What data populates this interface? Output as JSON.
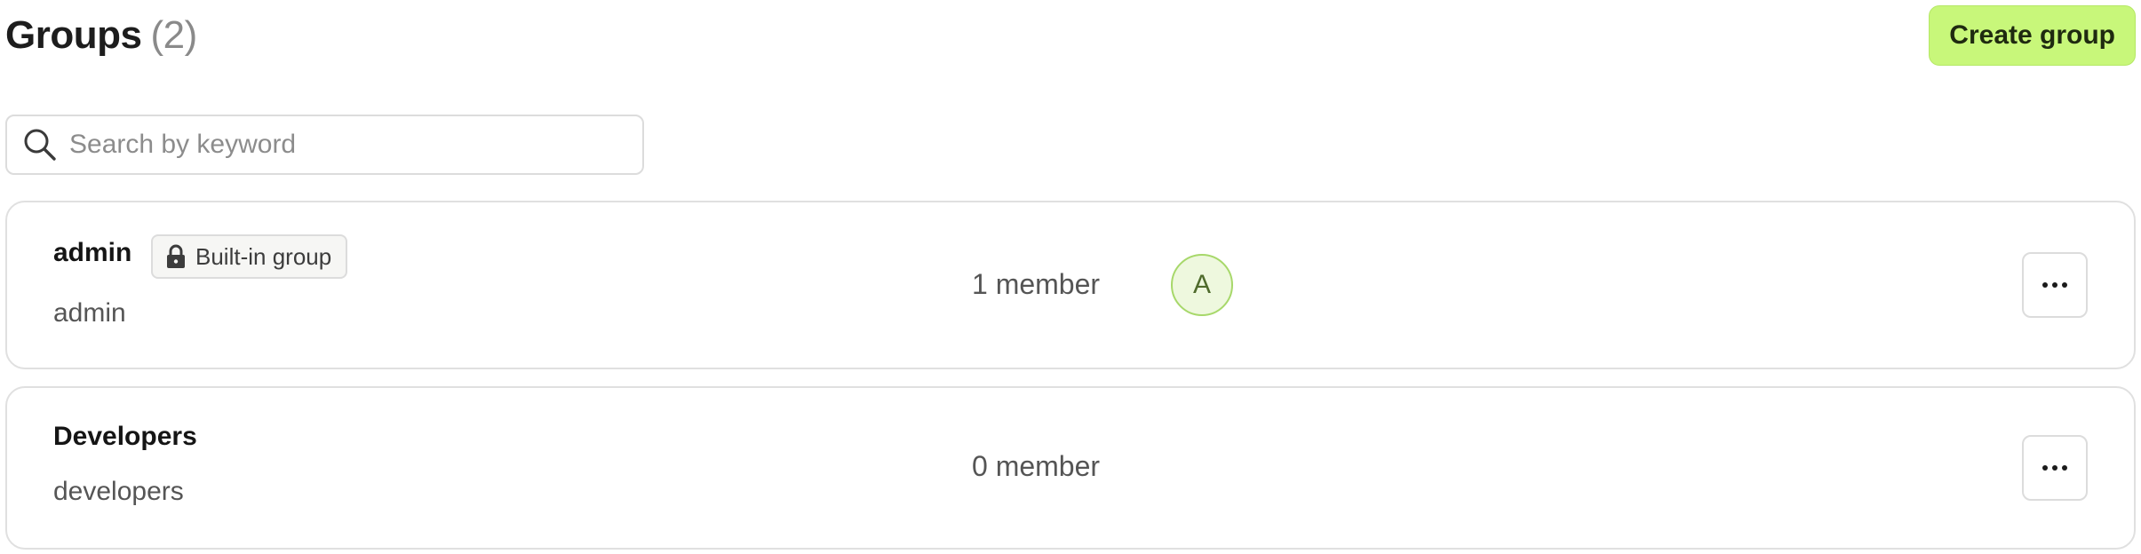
{
  "header": {
    "title": "Groups",
    "count": "(2)",
    "create_button_label": "Create group"
  },
  "search": {
    "placeholder": "Search by keyword",
    "value": ""
  },
  "groups": [
    {
      "name": "admin",
      "identifier": "admin",
      "badge": "Built-in group",
      "members_label": "1 member",
      "member_avatars": [
        "A"
      ]
    },
    {
      "name": "Developers",
      "identifier": "developers",
      "members_label": "0 member",
      "member_avatars": []
    }
  ],
  "colors": {
    "accent": "#c8f77a",
    "avatar_bg": "#eef8de",
    "avatar_border": "#a7d86a",
    "border": "#e0e0e0"
  },
  "icons": {
    "search": "search-icon",
    "lock": "lock-icon",
    "more": "more-horizontal-icon"
  }
}
